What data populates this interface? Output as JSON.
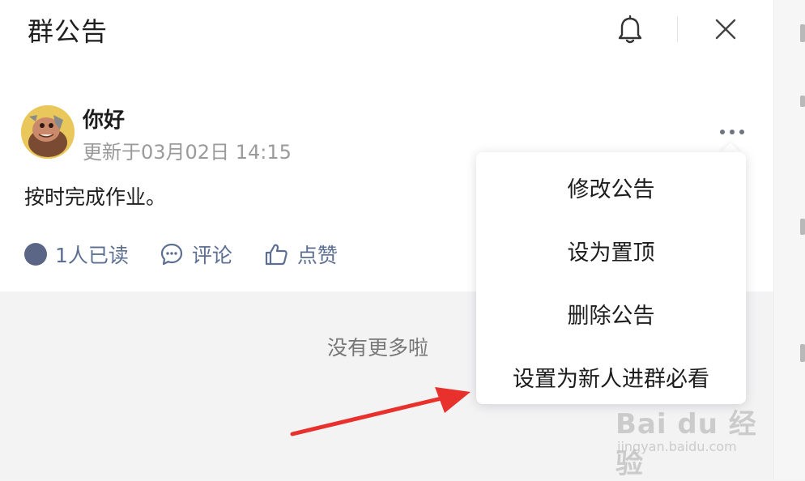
{
  "header": {
    "title": "群公告",
    "icons": [
      "bell-icon",
      "close-icon"
    ]
  },
  "post": {
    "author": "你好",
    "timestamp": "更新于03月02日 14:15",
    "content": "按时完成作业。",
    "actions": {
      "read": "1人已读",
      "comment": "评论",
      "like": "点赞"
    }
  },
  "footer": {
    "no_more": "没有更多啦"
  },
  "menu": {
    "items": [
      "修改公告",
      "设为置顶",
      "删除公告",
      "设置为新人进群必看"
    ]
  },
  "watermark": {
    "brand": "Bai du 经验",
    "url": "jingyan.baidu.com"
  },
  "colors": {
    "accent": "#5c6f93",
    "annotation_arrow": "#e8312c"
  }
}
